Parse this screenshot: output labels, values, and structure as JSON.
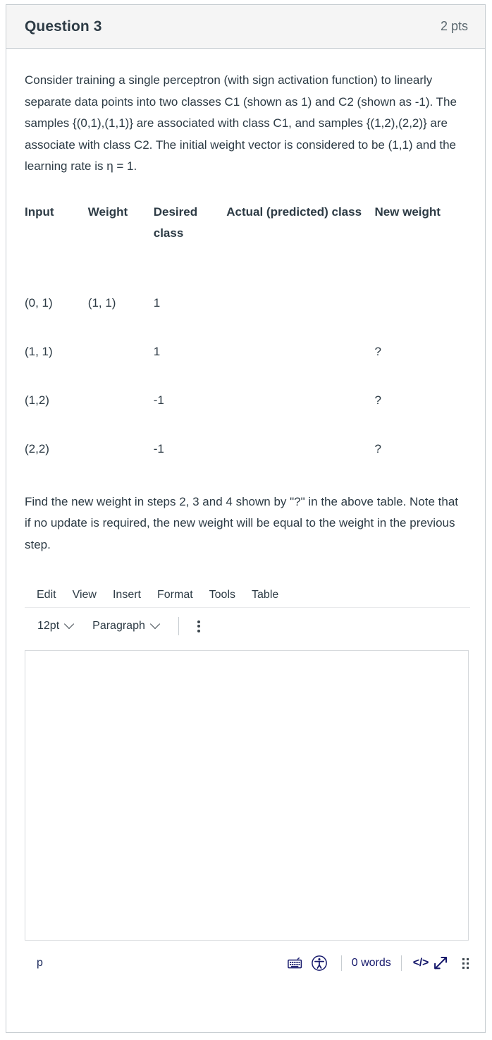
{
  "header": {
    "title": "Question 3",
    "points": "2 pts"
  },
  "question": {
    "prompt": "Consider training a single perceptron (with sign activation function) to linearly separate data points into two classes C1 (shown as 1) and C2 (shown as -1). The samples {(0,1),(1,1)} are associated with class C1, and samples {(1,2),(2,2)} are associate with class C2. The initial weight vector is considered to be (1,1) and the learning rate is η = 1.",
    "instruction": "Find the new weight in steps 2, 3 and 4 shown by \"?\" in the above table. Note that if no update is required, the new weight will be equal to the weight in the previous step."
  },
  "table": {
    "headers": [
      "Input",
      "Weight",
      "Desired class",
      "Actual (predicted) class",
      "New weight"
    ],
    "rows": [
      {
        "input": "(0, 1)",
        "weight": "(1, 1)",
        "desired": "1",
        "actual": "",
        "new_weight": ""
      },
      {
        "input": "(1, 1)",
        "weight": "",
        "desired": "1",
        "actual": "",
        "new_weight": "?"
      },
      {
        "input": "(1,2)",
        "weight": "",
        "desired": "-1",
        "actual": "",
        "new_weight": "?"
      },
      {
        "input": "(2,2)",
        "weight": "",
        "desired": "-1",
        "actual": "",
        "new_weight": "?"
      }
    ]
  },
  "editor": {
    "menubar": [
      "Edit",
      "View",
      "Insert",
      "Format",
      "Tools",
      "Table"
    ],
    "font_size": "12pt",
    "block_format": "Paragraph",
    "kebab_label": "",
    "content": "",
    "status": {
      "path": "p",
      "word_count": "0 words",
      "code_label": "</>",
      "keyboard_icon": "keyboard-shortcuts-icon",
      "accessibility_icon": "accessibility-checker-icon",
      "resize_icon": "resize-fullscreen-icon",
      "drag_icon": "resize-drag-handle-icon"
    }
  },
  "colors": {
    "text": "#2d3b45",
    "header_bg": "#f5f5f5",
    "border": "#c7cdd1",
    "status_blue": "#15186b"
  }
}
